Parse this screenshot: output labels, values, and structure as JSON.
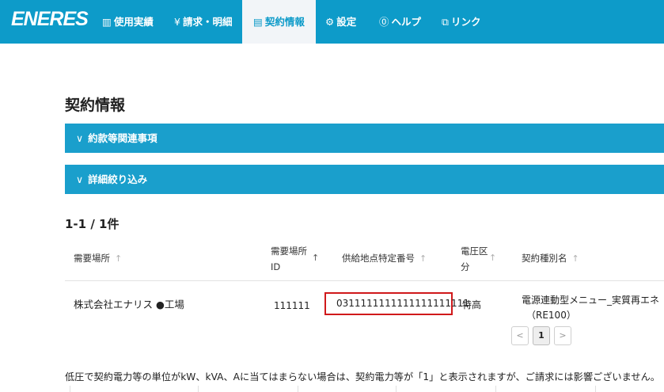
{
  "brand": {
    "logo": "ENERES"
  },
  "nav": {
    "items": [
      {
        "icon": "▥",
        "label": "使用実績"
      },
      {
        "icon": "¥",
        "label": "請求・明細"
      },
      {
        "icon": "▤",
        "label": "契約情報"
      },
      {
        "icon": "⚙",
        "label": "設定"
      },
      {
        "icon": "⓪",
        "label": "ヘルプ"
      },
      {
        "icon": "⧉",
        "label": "リンク"
      }
    ],
    "active_index": 2
  },
  "page": {
    "title": "契約情報"
  },
  "accordions": [
    {
      "chevron": "∨",
      "label": "約款等関連事項"
    },
    {
      "chevron": "∨",
      "label": "詳細絞り込み"
    }
  ],
  "results": {
    "count": "1-1 / 1件"
  },
  "table": {
    "headers": [
      {
        "line1": "需要場所",
        "line2": "",
        "sort": "↑"
      },
      {
        "line1": "需要場所",
        "line2": "ID",
        "sort": "↑"
      },
      {
        "line1": "供給地点特定番号",
        "line2": "",
        "sort": "↑"
      },
      {
        "line1": "電圧区",
        "line2": "分",
        "sort": "↑"
      },
      {
        "line1": "契約種別名",
        "line2": "",
        "sort": "↑"
      }
    ],
    "rows": [
      {
        "place": "株式会社エナリス ●工場",
        "place_id": "111111",
        "supply_point_number": "0311111111111111111111",
        "voltage": "特高",
        "contract_type_line1": "電源連動型メニュー_実質再エネ",
        "contract_type_line2": "（RE100）"
      }
    ]
  },
  "pagination": {
    "prev": "<",
    "current": "1",
    "next": ">"
  },
  "footer": {
    "note": "低圧で契約電力等の単位がkW、kVA、Aに当てはまらない場合は、契約電力等が「1」と表示されますが、ご請求には影響ございません。"
  },
  "colors": {
    "header_bg": "#0d9bc9",
    "accordion_bg": "#1a9fcc",
    "highlight_border": "#d0191b"
  }
}
